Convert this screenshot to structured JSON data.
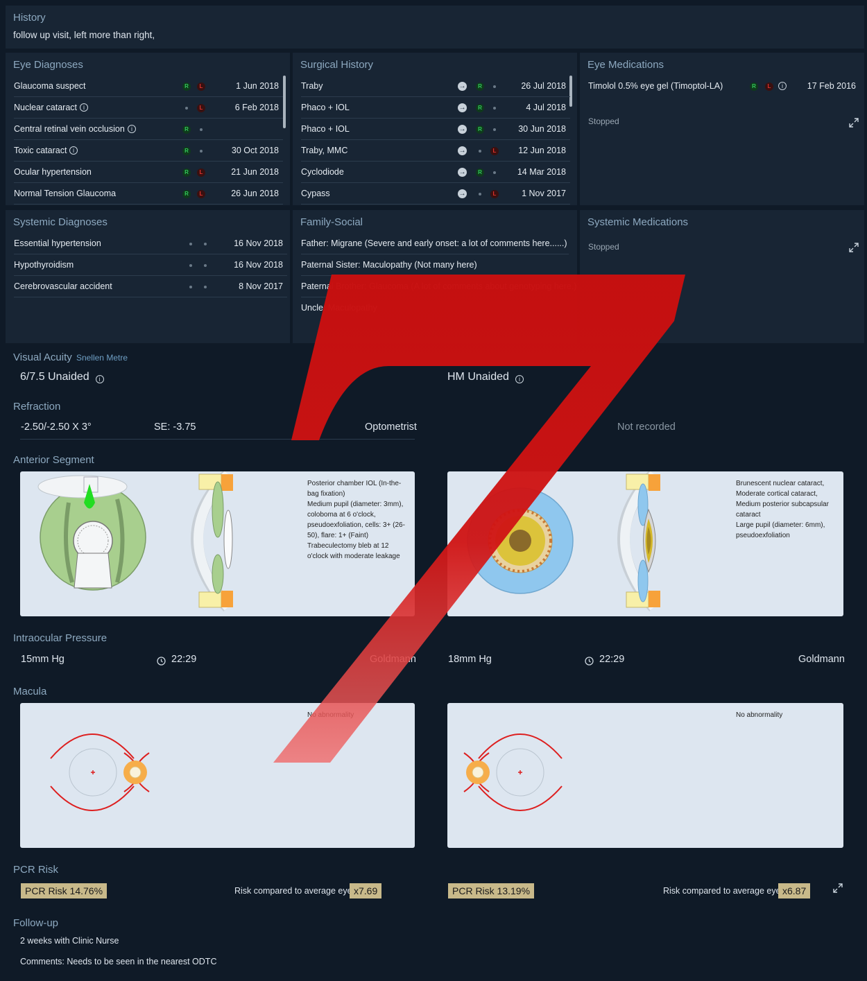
{
  "history": {
    "title": "History",
    "text": "follow up visit, left more than right,"
  },
  "eye_diagnoses": {
    "title": "Eye Diagnoses",
    "rows": [
      {
        "name": "Glaucoma suspect",
        "info": false,
        "right": "R",
        "left": "L",
        "date": "1 Jun 2018"
      },
      {
        "name": "Nuclear cataract",
        "info": true,
        "right": "",
        "left": "L",
        "date": "6 Feb 2018"
      },
      {
        "name": "Central retinal vein occlusion",
        "info": true,
        "right": "R",
        "left": "",
        "date": ""
      },
      {
        "name": "Toxic cataract",
        "info": true,
        "right": "R",
        "left": "",
        "date": "30 Oct 2018"
      },
      {
        "name": "Ocular hypertension",
        "info": false,
        "right": "R",
        "left": "L",
        "date": "21 Jun 2018"
      },
      {
        "name": "Normal Tension Glaucoma",
        "info": false,
        "right": "R",
        "left": "L",
        "date": "26 Jun 2018"
      }
    ]
  },
  "surgical_history": {
    "title": "Surgical History",
    "rows": [
      {
        "name": "Traby",
        "right": "R",
        "left": "",
        "date": "26 Jul 2018"
      },
      {
        "name": "Phaco + IOL",
        "right": "R",
        "left": "",
        "date": "4 Jul 2018"
      },
      {
        "name": "Phaco + IOL",
        "right": "R",
        "left": "",
        "date": "30 Jun 2018"
      },
      {
        "name": "Traby, MMC",
        "right": "",
        "left": "L",
        "date": "12 Jun 2018"
      },
      {
        "name": "Cyclodiode",
        "right": "R",
        "left": "",
        "date": "14 Mar 2018"
      },
      {
        "name": "Cypass",
        "right": "",
        "left": "L",
        "date": "1 Nov 2017"
      }
    ]
  },
  "eye_medications": {
    "title": "Eye Medications",
    "rows": [
      {
        "name": "Timolol 0.5% eye gel (Timoptol-LA)",
        "right": "R",
        "left": "L",
        "date": "17 Feb 2016"
      }
    ],
    "stopped": "Stopped"
  },
  "systemic_diagnoses": {
    "title": "Systemic Diagnoses",
    "rows": [
      {
        "name": "Essential hypertension",
        "date": "16 Nov 2018"
      },
      {
        "name": "Hypothyroidism",
        "date": "16 Nov 2018"
      },
      {
        "name": "Cerebrovascular accident",
        "date": "8 Nov 2017"
      }
    ]
  },
  "family_social": {
    "title": "Family-Social",
    "rows": [
      {
        "rel": "Father:",
        "text": "Migrane (Severe and early onset: a lot of comments here......)"
      },
      {
        "rel": "Paternal Sister:",
        "text": "Maculopathy (Not many here)"
      },
      {
        "rel": "Paternal Brother:",
        "text": "Glaucoma (A lot of comments about genotyping here.)"
      },
      {
        "rel": "Uncle:",
        "text": "Maculopathy"
      }
    ]
  },
  "systemic_medications": {
    "title": "Systemic Medications",
    "stopped": "Stopped"
  },
  "visual_acuity": {
    "title": "Visual Acuity",
    "subtitle": "Snellen Metre",
    "right": "6/7.5 Unaided",
    "left": "HM Unaided"
  },
  "refraction": {
    "title": "Refraction",
    "right_value": "-2.50/-2.50 X 3°",
    "right_se": "SE: -3.75",
    "right_source": "Optometrist",
    "left_value": "Not recorded"
  },
  "anterior_segment": {
    "title": "Anterior Segment",
    "right_notes": [
      "Posterior chamber IOL (In-the-",
      "bag fixation)",
      "Medium pupil (diameter: 3mm),",
      "coloboma at 6 o'clock,",
      "pseudoexfoliation, cells: 3+ (26-",
      "50), flare: 1+ (Faint)",
      "Trabeculectomy bleb at 12",
      "o'clock with moderate leakage"
    ],
    "left_notes": [
      "Brunescent nuclear cataract,",
      "Moderate cortical cataract,",
      "Medium posterior subcapsular",
      "cataract",
      "Large pupil (diameter: 6mm),",
      "pseudoexfoliation"
    ]
  },
  "iop": {
    "title": "Intraocular Pressure",
    "right_value": "15mm Hg",
    "right_time": "22:29",
    "right_method": "Goldmann",
    "left_value": "18mm Hg",
    "left_time": "22:29",
    "left_method": "Goldmann"
  },
  "macula": {
    "title": "Macula",
    "right_note": "No abnormality",
    "left_note": "No abnormality"
  },
  "pcr": {
    "title": "PCR Risk",
    "right_risk": "PCR Risk 14.76%",
    "right_compare": "Risk compared to average eye",
    "right_factor": "x7.69",
    "left_risk": "PCR Risk 13.19%",
    "left_compare": "Risk compared to average eye",
    "left_factor": "x6.87"
  },
  "followup": {
    "title": "Follow-up",
    "line1": "2 weeks with Clinic Nurse",
    "line2": "Comments: Needs to be seen in the nearest ODTC"
  },
  "colors": {
    "accent_title": "#8da9c0",
    "right_badge": "#32c85a",
    "left_badge": "#e0332e",
    "panel": "#182534",
    "background": "#0f1a27",
    "pcr_badge": "#c8b98a",
    "overlay": "#d01414"
  }
}
